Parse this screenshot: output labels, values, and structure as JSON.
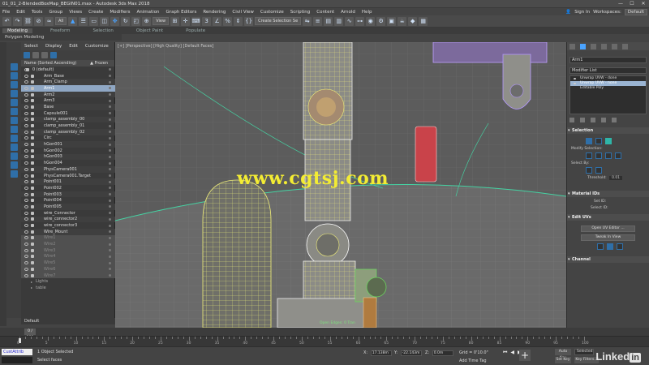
{
  "titlebar": {
    "title": "01_01_2-BlendedBoxMap_BEGIN01.max - Autodesk 3ds Max 2018",
    "minimize": "—",
    "maximize": "☐",
    "close": "✕"
  },
  "menubar": {
    "items": [
      "File",
      "Edit",
      "Tools",
      "Group",
      "Views",
      "Create",
      "Modifiers",
      "Animation",
      "Graph Editors",
      "Rendering",
      "Civil View",
      "Customize",
      "Scripting",
      "Content",
      "Arnold",
      "Help"
    ],
    "signin": "Sign In",
    "workspaces_label": "Workspaces:",
    "workspaces_value": "Default"
  },
  "toolbar": {
    "filter_value": "All",
    "refcoord_value": "View",
    "selection_set": "Create Selection Se"
  },
  "ribbon": {
    "tabs": [
      "Modeling",
      "Freeform",
      "Selection",
      "Object Paint",
      "Populate"
    ],
    "sub": "Polygon Modeling"
  },
  "explorer": {
    "tabs": [
      "Select",
      "Display",
      "Edit",
      "Customize"
    ],
    "header_name": "Name (Sorted Ascending)",
    "header_frozen": "▲ Frozen",
    "root": "0 (default)",
    "rows": [
      "Arm_Base",
      "Arm_Clamp",
      "Arm1",
      "Arm2",
      "Arm3",
      "Base",
      "Capsule001",
      "clamp_assembly_00",
      "clamp_assembly_01",
      "clamp_assembly_02",
      "Circ",
      "hGon001",
      "hGon002",
      "hGon003",
      "hGon004",
      "PhysCamera001",
      "PhysCamera001.Target",
      "Point001",
      "Point002",
      "Point003",
      "Point004",
      "Point005",
      "wire_Connector",
      "wire_connector2",
      "wire_connector3",
      "Wire_Mount"
    ],
    "dim_rows": [
      "Wire1",
      "Wire2",
      "Wire3",
      "Wire4",
      "Wire5",
      "Wire6",
      "Wire7"
    ],
    "groups": [
      "Lights",
      "table"
    ],
    "layer_label": "Default"
  },
  "viewport": {
    "label": "[+] [Perspective] [High Quality] [Default Faces]",
    "watermark": "www.cgtsj.com",
    "open_edges": "Open Edges: 0 Tran"
  },
  "cmdpanel": {
    "object_name": "Arm1",
    "modifier_list": "Modifier List",
    "stack": [
      "Unwrap UVW - done",
      "Unwrap UVW - none",
      "Editable Poly"
    ],
    "rollouts": {
      "selection": "Selection",
      "modify_selection": "Modify Selection:",
      "select_by": "Select By:",
      "threshold_label": "Threshold:",
      "threshold_value": "0.01",
      "material_ids": "Material IDs",
      "set_id": "Set ID:",
      "select_id": "Select ID:",
      "edit_uvs": "Edit UVs",
      "open_uv_editor": "Open UV Editor ...",
      "tweak_in_view": "Tweak In View",
      "channel": "Channel"
    }
  },
  "timeline": {
    "frame": "0 / 100",
    "ticks": [
      "0",
      "5",
      "10",
      "15",
      "20",
      "25",
      "30",
      "35",
      "40",
      "45",
      "50",
      "55",
      "60",
      "65",
      "70",
      "75",
      "80",
      "85",
      "90",
      "95",
      "100"
    ]
  },
  "statusbar": {
    "maxscript": "CustAttrib",
    "status1": "1 Object Selected",
    "status2": "Select faces",
    "x_label": "X:",
    "x_value": "17.138m",
    "y_label": "Y:",
    "y_value": "-22.143m",
    "z_label": "Z:",
    "z_value": "0.0m",
    "grid": "Grid = 0'10.0\"",
    "add_time_tag": "Add Time Tag",
    "auto_key": "Auto Key",
    "set_key": "Set Key",
    "selected": "Selected",
    "key_filters": "Key Filters..."
  },
  "linkedin": {
    "text": "Linked",
    "badge": "in"
  }
}
